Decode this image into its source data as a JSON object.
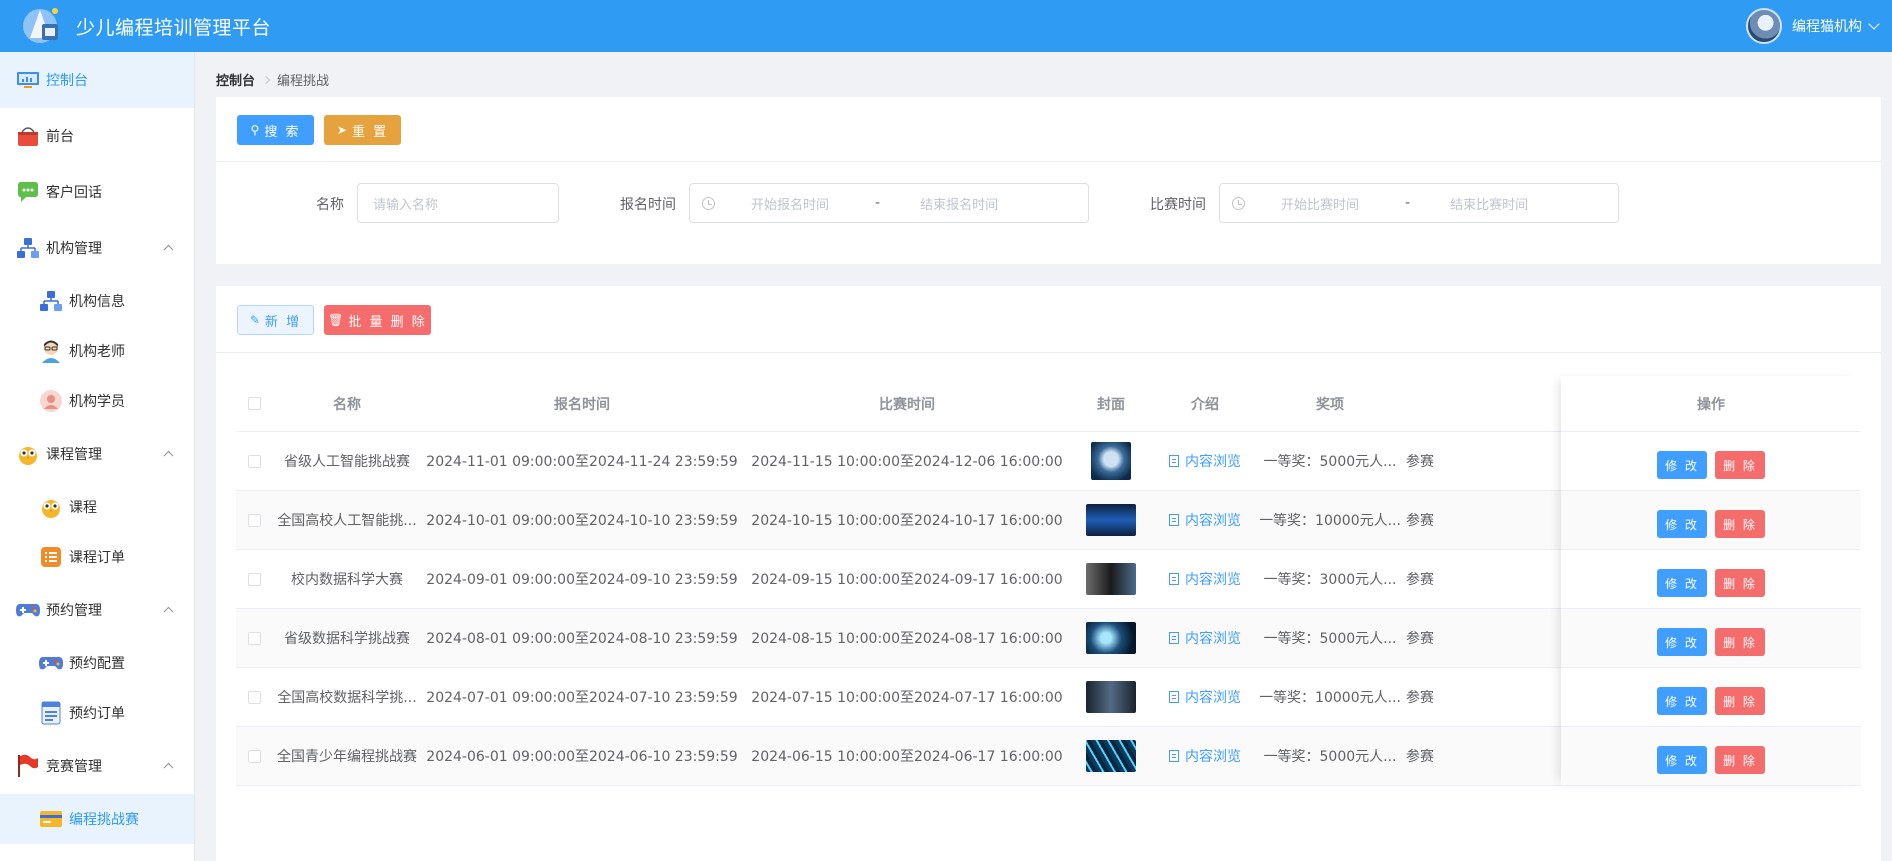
{
  "app": {
    "title": "少儿编程培训管理平台"
  },
  "user": {
    "name": "编程猫机构"
  },
  "sidebar": {
    "items": [
      {
        "label": "控制台",
        "icon": "monitor-icon",
        "level": 0,
        "active": true
      },
      {
        "label": "前台",
        "icon": "shop-basket-icon",
        "level": 0
      },
      {
        "label": "客户回话",
        "icon": "chat-bubble-icon",
        "level": 0
      },
      {
        "label": "机构管理",
        "icon": "org-chart-icon",
        "level": 0,
        "expanded": true
      },
      {
        "label": "机构信息",
        "icon": "org-chart-icon",
        "level": 1
      },
      {
        "label": "机构老师",
        "icon": "teacher-icon",
        "level": 1
      },
      {
        "label": "机构学员",
        "icon": "student-icon",
        "level": 1
      },
      {
        "label": "课程管理",
        "icon": "owl-icon",
        "level": 0,
        "expanded": true
      },
      {
        "label": "课程",
        "icon": "owl-icon",
        "level": 1
      },
      {
        "label": "课程订单",
        "icon": "list-icon",
        "level": 1
      },
      {
        "label": "预约管理",
        "icon": "gamepad-icon",
        "level": 0,
        "expanded": true
      },
      {
        "label": "预约配置",
        "icon": "gamepad-icon",
        "level": 1
      },
      {
        "label": "预约订单",
        "icon": "form-icon",
        "level": 1
      },
      {
        "label": "竞赛管理",
        "icon": "flag-icon",
        "level": 0,
        "expanded": true
      },
      {
        "label": "编程挑战赛",
        "icon": "card-icon",
        "level": 1,
        "active": true
      }
    ]
  },
  "breadcrumb": {
    "first": "控制台",
    "current": "编程挑战"
  },
  "search": {
    "search_label": "搜 索",
    "reset_label": "重 置",
    "name_label": "名称",
    "name_placeholder": "请输入名称",
    "signup_label": "报名时间",
    "signup_start_ph": "开始报名时间",
    "signup_end_ph": "结束报名时间",
    "match_label": "比赛时间",
    "match_start_ph": "开始比赛时间",
    "match_end_ph": "结束比赛时间",
    "range_sep": "-"
  },
  "actions": {
    "add_label": "新 增",
    "batch_delete_label": "批 量 删 除"
  },
  "table": {
    "columns": [
      "名称",
      "报名时间",
      "比赛时间",
      "封面",
      "介绍",
      "奖项",
      "操作"
    ],
    "edit_label": "修 改",
    "delete_label": "删 除",
    "intro_label": "内容浏览",
    "rows": [
      {
        "name": "省级人工智能挑战赛",
        "signup": "2024-11-01 09:00:00至2024-11-24 23:59:59",
        "match": "2024-11-15 10:00:00至2024-12-06 16:00:00",
        "award": "一等奖：5000元人...",
        "extra": "参赛"
      },
      {
        "name": "全国高校人工智能挑...",
        "signup": "2024-10-01 09:00:00至2024-10-10 23:59:59",
        "match": "2024-10-15 10:00:00至2024-10-17 16:00:00",
        "award": "一等奖：10000元人...",
        "extra": "参赛"
      },
      {
        "name": "校内数据科学大赛",
        "signup": "2024-09-01 09:00:00至2024-09-10 23:59:59",
        "match": "2024-09-15 10:00:00至2024-09-17 16:00:00",
        "award": "一等奖：3000元人...",
        "extra": "参赛"
      },
      {
        "name": "省级数据科学挑战赛",
        "signup": "2024-08-01 09:00:00至2024-08-10 23:59:59",
        "match": "2024-08-15 10:00:00至2024-08-17 16:00:00",
        "award": "一等奖：5000元人...",
        "extra": "参赛"
      },
      {
        "name": "全国高校数据科学挑...",
        "signup": "2024-07-01 09:00:00至2024-07-10 23:59:59",
        "match": "2024-07-15 10:00:00至2024-07-17 16:00:00",
        "award": "一等奖：10000元人...",
        "extra": "参赛"
      },
      {
        "name": "全国青少年编程挑战赛",
        "signup": "2024-06-01 09:00:00至2024-06-10 23:59:59",
        "match": "2024-06-15 10:00:00至2024-06-17 16:00:00",
        "award": "一等奖：5000元人...",
        "extra": "参赛"
      }
    ]
  },
  "colors": {
    "header": "#2f9bf2",
    "primary": "#409eff",
    "warning": "#e6a23c",
    "danger": "#f56c6c"
  }
}
